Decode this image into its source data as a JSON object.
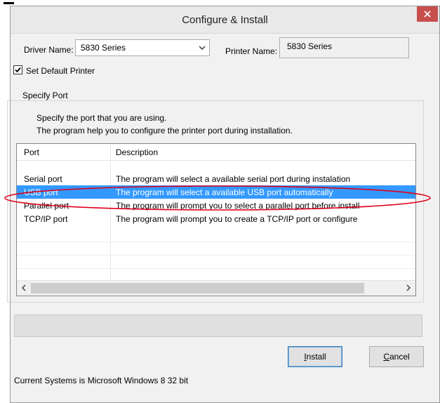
{
  "window": {
    "title": "Configure & Install"
  },
  "driver": {
    "label": "Driver Name:",
    "value": "5830 Series"
  },
  "printer": {
    "label": "Printer Name:",
    "value": "5830 Series"
  },
  "default_printer": {
    "label": "Set Default Printer",
    "checked": true
  },
  "port_group": {
    "title": "Specify Port",
    "line1": "Specify the port that you are using.",
    "line2": "The program help you to configure the printer port during installation."
  },
  "port_list": {
    "headers": {
      "port": "Port",
      "description": "Description"
    },
    "rows": [
      {
        "port": "Serial port",
        "description": "The program will select a available serial port during instalation"
      },
      {
        "port": "USB port",
        "description": "The program will select a available USB port automatically",
        "selected": true
      },
      {
        "port": "Parallel port",
        "description": "The program will prompt you to select a parallel port before install"
      },
      {
        "port": "TCP/IP port",
        "description": "The program will prompt you to create a TCP/IP port or configure"
      }
    ]
  },
  "buttons": {
    "install_accel": "I",
    "install_rest": "nstall",
    "cancel_accel": "C",
    "cancel_rest": "ancel"
  },
  "status": {
    "system_info": "Current Systems is Microsoft Windows 8  32 bit"
  },
  "colors": {
    "selection": "#3399ff",
    "close_button": "#c7504f",
    "highlight_ellipse": "#e0001b"
  }
}
